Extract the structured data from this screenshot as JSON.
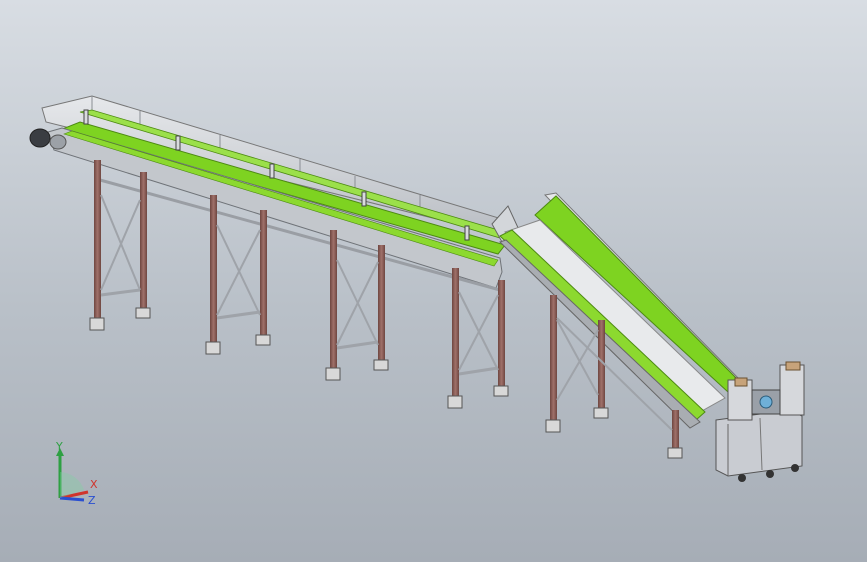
{
  "view": {
    "background_top": "#d8dde3",
    "background_bottom": "#a6adb6"
  },
  "model": {
    "belt_color": "#7ed321",
    "frame_color": "#b8bcc2",
    "leg_color": "#8a5a52",
    "machine_color": "#c9ccd2"
  },
  "triad": {
    "y_label": "Y",
    "x_label": "X",
    "z_label": "Z",
    "y_color": "#2ea043",
    "x_color": "#d0342c",
    "z_color": "#2a4fd0"
  }
}
